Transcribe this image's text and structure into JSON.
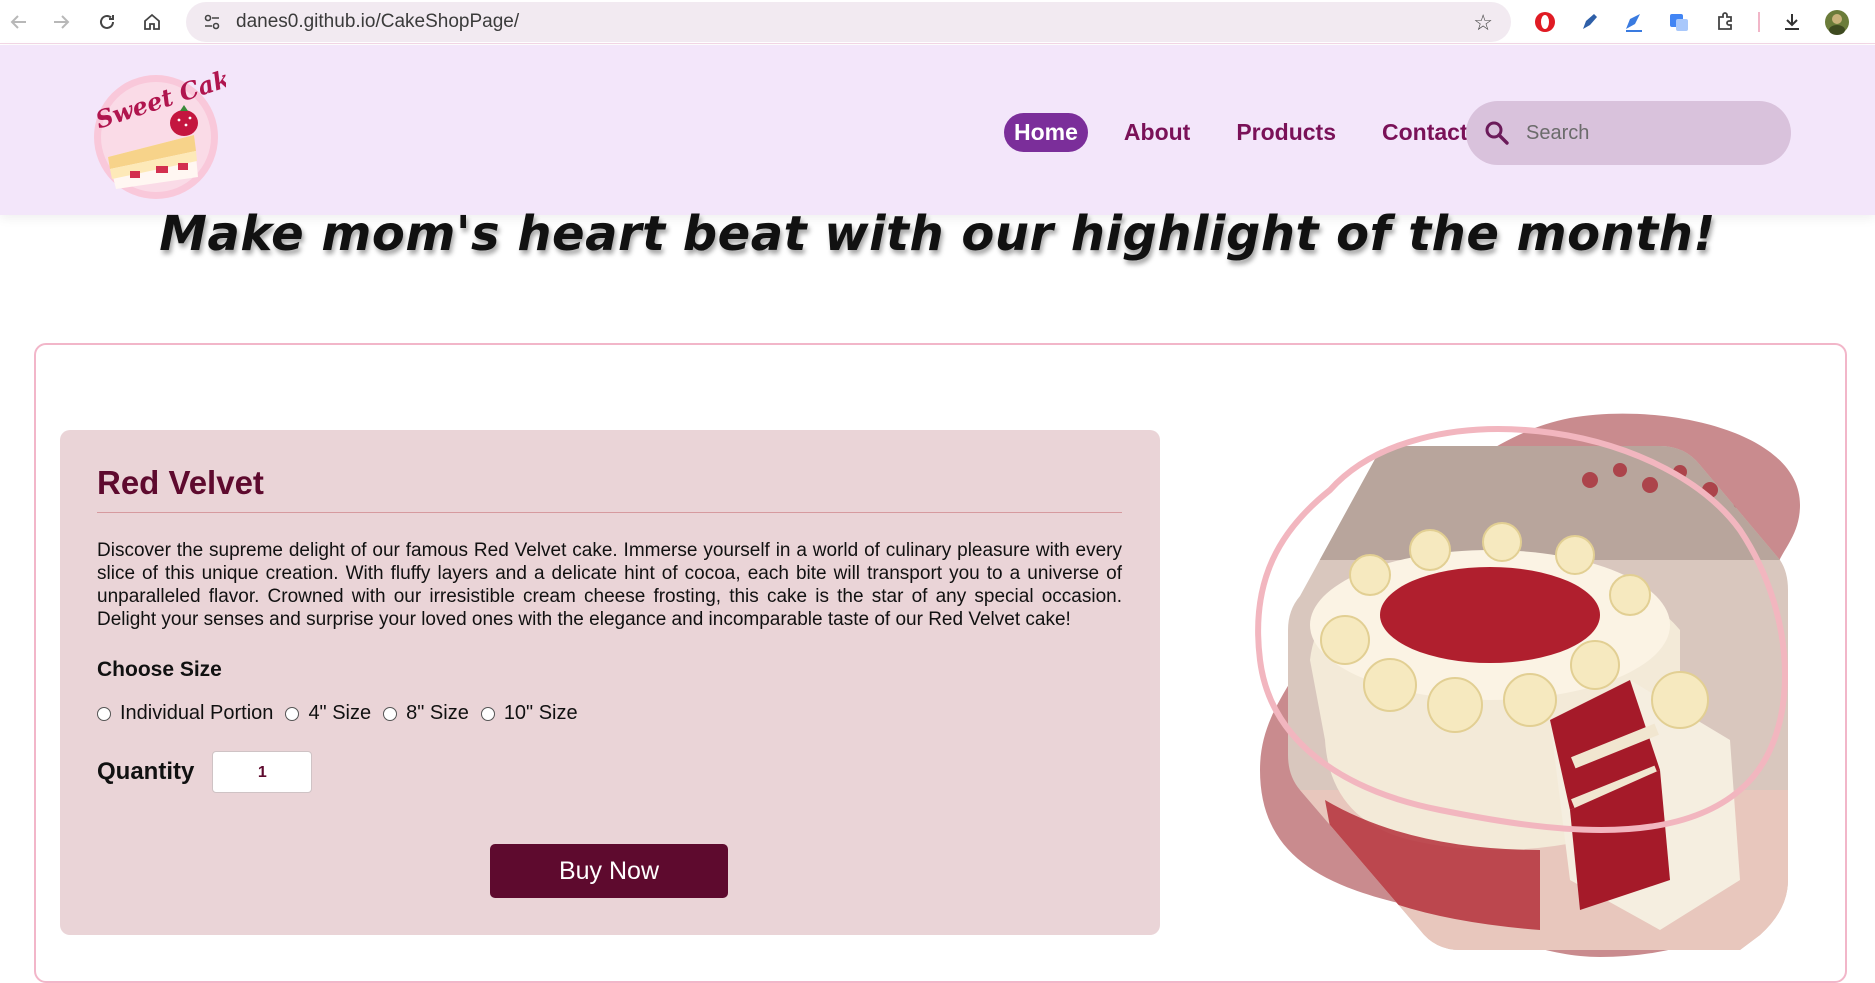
{
  "browser": {
    "url": "danes0.github.io/CakeShopPage/"
  },
  "site": {
    "logo_text": "Sweet Cake",
    "nav": [
      {
        "label": "Home",
        "active": true
      },
      {
        "label": "About",
        "active": false
      },
      {
        "label": "Products",
        "active": false
      },
      {
        "label": "Contact",
        "active": false
      }
    ],
    "search_placeholder": "Search"
  },
  "banner": {
    "text": "Make mom's heart beat with our highlight of the month!"
  },
  "product": {
    "title": "Red Velvet",
    "description": "Discover the supreme delight of our famous Red Velvet cake. Immerse yourself in a world of culinary pleasure with every slice of this unique creation. With fluffy layers and a delicate hint of cocoa, each bite will transport you to a universe of unparalleled flavor. Crowned with our irresistible cream cheese frosting, this cake is the star of any special occasion. Delight your senses and surprise your loved ones with the elegance and incomparable taste of our Red Velvet cake!",
    "size_label": "Choose Size",
    "sizes": [
      "Individual Portion",
      "4\" Size",
      "8\" Size",
      "10\" Size"
    ],
    "quantity_label": "Quantity",
    "quantity_value": "1",
    "buy_label": "Buy Now"
  },
  "colors": {
    "header_bg": "#f3e6fa",
    "nav_text": "#7a1158",
    "nav_active_bg": "#7b2e9a",
    "panel_bg": "#ead4d7",
    "accent": "#5e0a2e"
  }
}
